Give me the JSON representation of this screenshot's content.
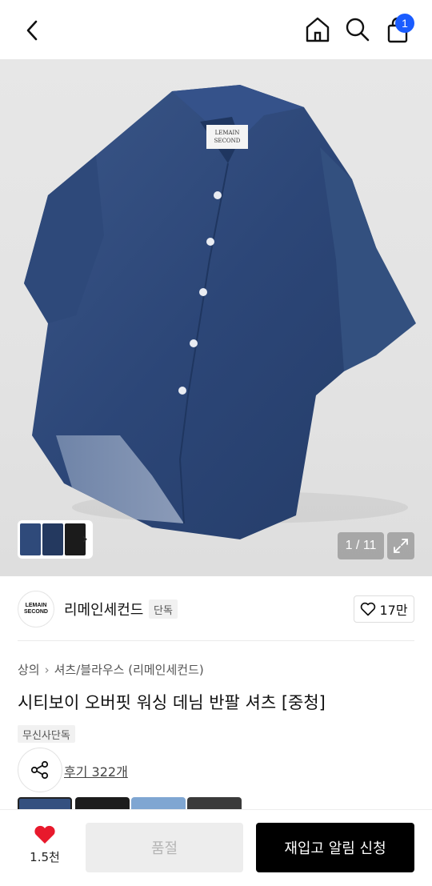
{
  "header": {
    "cart_count": "1",
    "icons": [
      "back-icon",
      "home-icon",
      "search-icon",
      "shopping-bag-icon"
    ]
  },
  "gallery": {
    "counter": "1 / 11",
    "thumb_arrow": "›"
  },
  "brand": {
    "logo_text_line1": "LEMAIN",
    "logo_text_line2": "SECOND",
    "name": "리메인세컨드",
    "tag": "단독",
    "likes": "17만"
  },
  "product": {
    "breadcrumb": [
      "상의",
      "셔츠/블라우스 (리메인세컨드)"
    ],
    "title": "시티보이 오버핏 워싱 데님 반팔 셔츠 [중청]",
    "exclusive_badge": "무신사단독",
    "review_link": "후기 322개"
  },
  "bottom_bar": {
    "like_count": "1.5천",
    "soldout_label": "품절",
    "restock_label": "재입고 알림 신청"
  },
  "colors": {
    "accent_blue": "#1a5cff",
    "heart_red": "#e8192c",
    "denim": "#2f4a7a"
  }
}
